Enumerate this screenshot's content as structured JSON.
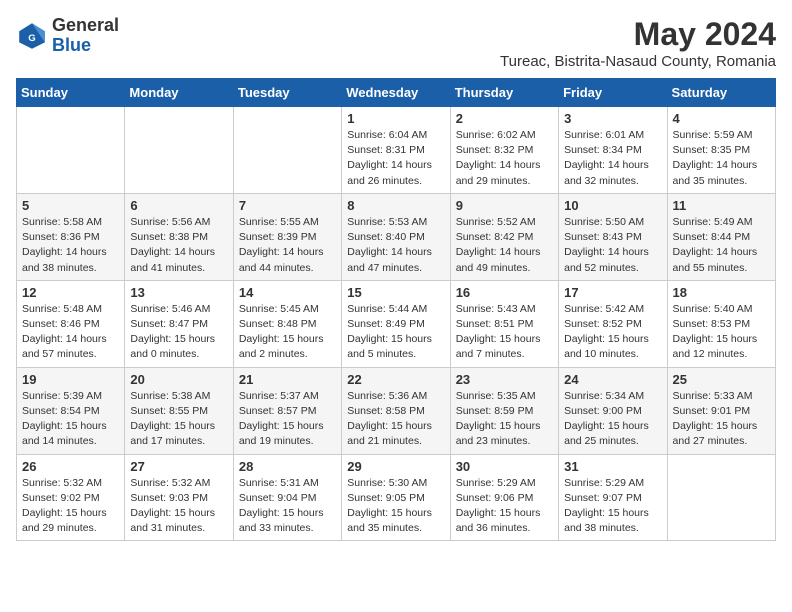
{
  "header": {
    "logo_general": "General",
    "logo_blue": "Blue",
    "month_year": "May 2024",
    "location": "Tureac, Bistrita-Nasaud County, Romania"
  },
  "weekdays": [
    "Sunday",
    "Monday",
    "Tuesday",
    "Wednesday",
    "Thursday",
    "Friday",
    "Saturday"
  ],
  "weeks": [
    [
      {
        "day": "",
        "info": ""
      },
      {
        "day": "",
        "info": ""
      },
      {
        "day": "",
        "info": ""
      },
      {
        "day": "1",
        "info": "Sunrise: 6:04 AM\nSunset: 8:31 PM\nDaylight: 14 hours\nand 26 minutes."
      },
      {
        "day": "2",
        "info": "Sunrise: 6:02 AM\nSunset: 8:32 PM\nDaylight: 14 hours\nand 29 minutes."
      },
      {
        "day": "3",
        "info": "Sunrise: 6:01 AM\nSunset: 8:34 PM\nDaylight: 14 hours\nand 32 minutes."
      },
      {
        "day": "4",
        "info": "Sunrise: 5:59 AM\nSunset: 8:35 PM\nDaylight: 14 hours\nand 35 minutes."
      }
    ],
    [
      {
        "day": "5",
        "info": "Sunrise: 5:58 AM\nSunset: 8:36 PM\nDaylight: 14 hours\nand 38 minutes."
      },
      {
        "day": "6",
        "info": "Sunrise: 5:56 AM\nSunset: 8:38 PM\nDaylight: 14 hours\nand 41 minutes."
      },
      {
        "day": "7",
        "info": "Sunrise: 5:55 AM\nSunset: 8:39 PM\nDaylight: 14 hours\nand 44 minutes."
      },
      {
        "day": "8",
        "info": "Sunrise: 5:53 AM\nSunset: 8:40 PM\nDaylight: 14 hours\nand 47 minutes."
      },
      {
        "day": "9",
        "info": "Sunrise: 5:52 AM\nSunset: 8:42 PM\nDaylight: 14 hours\nand 49 minutes."
      },
      {
        "day": "10",
        "info": "Sunrise: 5:50 AM\nSunset: 8:43 PM\nDaylight: 14 hours\nand 52 minutes."
      },
      {
        "day": "11",
        "info": "Sunrise: 5:49 AM\nSunset: 8:44 PM\nDaylight: 14 hours\nand 55 minutes."
      }
    ],
    [
      {
        "day": "12",
        "info": "Sunrise: 5:48 AM\nSunset: 8:46 PM\nDaylight: 14 hours\nand 57 minutes."
      },
      {
        "day": "13",
        "info": "Sunrise: 5:46 AM\nSunset: 8:47 PM\nDaylight: 15 hours\nand 0 minutes."
      },
      {
        "day": "14",
        "info": "Sunrise: 5:45 AM\nSunset: 8:48 PM\nDaylight: 15 hours\nand 2 minutes."
      },
      {
        "day": "15",
        "info": "Sunrise: 5:44 AM\nSunset: 8:49 PM\nDaylight: 15 hours\nand 5 minutes."
      },
      {
        "day": "16",
        "info": "Sunrise: 5:43 AM\nSunset: 8:51 PM\nDaylight: 15 hours\nand 7 minutes."
      },
      {
        "day": "17",
        "info": "Sunrise: 5:42 AM\nSunset: 8:52 PM\nDaylight: 15 hours\nand 10 minutes."
      },
      {
        "day": "18",
        "info": "Sunrise: 5:40 AM\nSunset: 8:53 PM\nDaylight: 15 hours\nand 12 minutes."
      }
    ],
    [
      {
        "day": "19",
        "info": "Sunrise: 5:39 AM\nSunset: 8:54 PM\nDaylight: 15 hours\nand 14 minutes."
      },
      {
        "day": "20",
        "info": "Sunrise: 5:38 AM\nSunset: 8:55 PM\nDaylight: 15 hours\nand 17 minutes."
      },
      {
        "day": "21",
        "info": "Sunrise: 5:37 AM\nSunset: 8:57 PM\nDaylight: 15 hours\nand 19 minutes."
      },
      {
        "day": "22",
        "info": "Sunrise: 5:36 AM\nSunset: 8:58 PM\nDaylight: 15 hours\nand 21 minutes."
      },
      {
        "day": "23",
        "info": "Sunrise: 5:35 AM\nSunset: 8:59 PM\nDaylight: 15 hours\nand 23 minutes."
      },
      {
        "day": "24",
        "info": "Sunrise: 5:34 AM\nSunset: 9:00 PM\nDaylight: 15 hours\nand 25 minutes."
      },
      {
        "day": "25",
        "info": "Sunrise: 5:33 AM\nSunset: 9:01 PM\nDaylight: 15 hours\nand 27 minutes."
      }
    ],
    [
      {
        "day": "26",
        "info": "Sunrise: 5:32 AM\nSunset: 9:02 PM\nDaylight: 15 hours\nand 29 minutes."
      },
      {
        "day": "27",
        "info": "Sunrise: 5:32 AM\nSunset: 9:03 PM\nDaylight: 15 hours\nand 31 minutes."
      },
      {
        "day": "28",
        "info": "Sunrise: 5:31 AM\nSunset: 9:04 PM\nDaylight: 15 hours\nand 33 minutes."
      },
      {
        "day": "29",
        "info": "Sunrise: 5:30 AM\nSunset: 9:05 PM\nDaylight: 15 hours\nand 35 minutes."
      },
      {
        "day": "30",
        "info": "Sunrise: 5:29 AM\nSunset: 9:06 PM\nDaylight: 15 hours\nand 36 minutes."
      },
      {
        "day": "31",
        "info": "Sunrise: 5:29 AM\nSunset: 9:07 PM\nDaylight: 15 hours\nand 38 minutes."
      },
      {
        "day": "",
        "info": ""
      }
    ]
  ]
}
